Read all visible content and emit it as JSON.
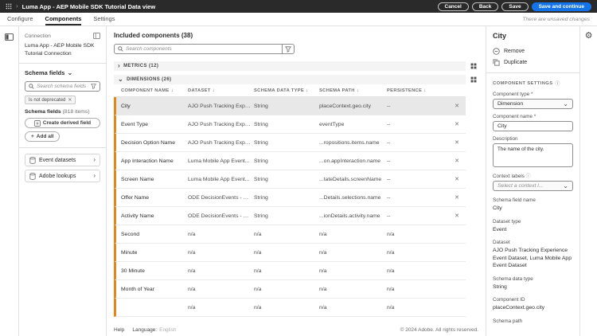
{
  "icons": {
    "close": "✕",
    "chevron_down": "⌄",
    "chevron_right": "›",
    "sort": "↓",
    "gear": "⚙",
    "info": "ⓘ",
    "plus": "+"
  },
  "colors": {
    "accent": "#1473e6",
    "modified_orange": "#e68619"
  },
  "topbar": {
    "title": "Luma App - AEP Mobile SDK Tutorial Data view",
    "cancel": "Cancel",
    "back": "Back",
    "save": "Save",
    "save_continue": "Save and continue"
  },
  "tabs": {
    "configure": "Configure",
    "components": "Components",
    "settings": "Settings",
    "unsaved": "There are unsaved changes"
  },
  "sidebar": {
    "connection_label": "Connection",
    "connection_name": "Luma App - AEP Mobile SDK Tutorial Connection",
    "schema_picker": "Schema fields",
    "search_placeholder": "Search schema fields",
    "filter_chip": "Is not deprecated",
    "fields_title": "Schema fields",
    "fields_count": "(818 items)",
    "create_derived_field": "Create derived field",
    "add_all": "Add all",
    "items": [
      {
        "label": "Event datasets"
      },
      {
        "label": "Adobe lookups"
      }
    ]
  },
  "main": {
    "title": "Included components (38)",
    "search_placeholder": "Search components",
    "metrics_section": "Metrics (12)",
    "dimensions_section": "Dimensions (26)",
    "headers": {
      "name": "Component name",
      "dataset": "Dataset",
      "type": "Schema data type",
      "path": "Schema path",
      "persistence": "Persistence"
    },
    "rows": [
      {
        "name": "City",
        "dataset": "AJO Push Tracking Expe...",
        "type": "String",
        "path": "placeContext.geo.city",
        "persistence": "--"
      },
      {
        "name": "Event Type",
        "dataset": "AJO Push Tracking Expe...",
        "type": "String",
        "path": "eventType",
        "persistence": "--"
      },
      {
        "name": "Decision Option Name",
        "dataset": "AJO Push Tracking Expe...",
        "type": "String",
        "path": "...ropositions.items.name",
        "persistence": "--"
      },
      {
        "name": "App Interaction Name",
        "dataset": "Luma Mobile App Event...",
        "type": "String",
        "path": "...on.appInteraction.name",
        "persistence": "--"
      },
      {
        "name": "Screen Name",
        "dataset": "Luma Mobile App Event...",
        "type": "String",
        "path": "...tateDetails.screenName",
        "persistence": "--"
      },
      {
        "name": "Offer Name",
        "dataset": "ODE DecisionEvents - m...",
        "type": "String",
        "path": "...Details.selections.name",
        "persistence": "--"
      },
      {
        "name": "Activity Name",
        "dataset": "ODE DecisionEvents - m...",
        "type": "String",
        "path": "...ionDetails.activity.name",
        "persistence": "--"
      },
      {
        "name": "Second",
        "dataset": "n/a",
        "type": "n/a",
        "path": "n/a",
        "persistence": "n/a"
      },
      {
        "name": "Minute",
        "dataset": "n/a",
        "type": "n/a",
        "path": "n/a",
        "persistence": "n/a"
      },
      {
        "name": "30 Minute",
        "dataset": "n/a",
        "type": "n/a",
        "path": "n/a",
        "persistence": "n/a"
      },
      {
        "name": "Month of Year",
        "dataset": "n/a",
        "type": "n/a",
        "path": "n/a",
        "persistence": "n/a"
      },
      {
        "name": "",
        "dataset": "n/a",
        "type": "n/a",
        "path": "n/a",
        "persistence": "n/a"
      }
    ],
    "footer": {
      "help": "Help",
      "language_label": "Language:",
      "language_value": "English",
      "copyright": "© 2024 Adobe. All rights reserved."
    }
  },
  "panel": {
    "title": "City",
    "remove": "Remove",
    "duplicate": "Duplicate",
    "settings_header": "Component settings",
    "component_type_label": "Component type *",
    "component_type_value": "Dimension",
    "component_name_label": "Component name *",
    "component_name_value": "City",
    "description_label": "Description",
    "description_value": "The name of the city.",
    "context_labels_label": "Context labels",
    "context_labels_placeholder": "Select a context l...",
    "readonly": [
      {
        "label": "Schema field name",
        "value": "City"
      },
      {
        "label": "Dataset type",
        "value": "Event"
      },
      {
        "label": "Dataset",
        "value": "AJO Push Tracking Experience Event Dataset, Luma Mobile App Event Dataset"
      },
      {
        "label": "Schema data type",
        "value": "String"
      },
      {
        "label": "Component ID",
        "value": "placeContext.geo.city"
      },
      {
        "label": "Schema path",
        "value": ""
      }
    ]
  }
}
